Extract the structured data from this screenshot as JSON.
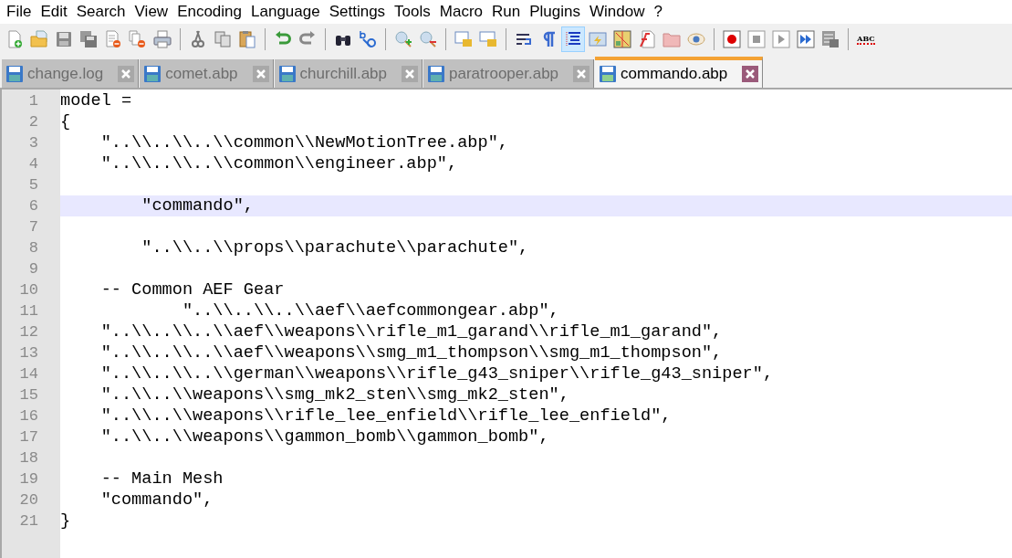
{
  "menu": [
    {
      "label": "File"
    },
    {
      "label": "Edit"
    },
    {
      "label": "Search"
    },
    {
      "label": "View"
    },
    {
      "label": "Encoding"
    },
    {
      "label": "Language"
    },
    {
      "label": "Settings"
    },
    {
      "label": "Tools"
    },
    {
      "label": "Macro"
    },
    {
      "label": "Run"
    },
    {
      "label": "Plugins"
    },
    {
      "label": "Window"
    },
    {
      "label": "?"
    }
  ],
  "toolbar": [
    {
      "kind": "new",
      "pressed": false
    },
    {
      "kind": "open",
      "pressed": false
    },
    {
      "kind": "save",
      "pressed": false
    },
    {
      "kind": "save-all",
      "pressed": false
    },
    {
      "kind": "close",
      "pressed": false
    },
    {
      "kind": "close-all",
      "pressed": false
    },
    {
      "kind": "print",
      "pressed": false
    },
    {
      "kind": "separator"
    },
    {
      "kind": "cut",
      "pressed": false
    },
    {
      "kind": "copy",
      "pressed": false
    },
    {
      "kind": "paste",
      "pressed": false
    },
    {
      "kind": "separator"
    },
    {
      "kind": "undo",
      "pressed": false
    },
    {
      "kind": "redo",
      "pressed": false
    },
    {
      "kind": "separator"
    },
    {
      "kind": "find",
      "pressed": false
    },
    {
      "kind": "replace",
      "pressed": false
    },
    {
      "kind": "separator"
    },
    {
      "kind": "zoom-in",
      "pressed": false
    },
    {
      "kind": "zoom-out",
      "pressed": false
    },
    {
      "kind": "separator"
    },
    {
      "kind": "sync-vertical",
      "pressed": false
    },
    {
      "kind": "sync-horizontal",
      "pressed": false
    },
    {
      "kind": "separator"
    },
    {
      "kind": "word-wrap",
      "pressed": false
    },
    {
      "kind": "show-all",
      "pressed": false
    },
    {
      "kind": "indent-guide",
      "pressed": true
    },
    {
      "kind": "language",
      "pressed": false
    },
    {
      "kind": "doc-map",
      "pressed": false
    },
    {
      "kind": "function-list",
      "pressed": false
    },
    {
      "kind": "folder",
      "pressed": false
    },
    {
      "kind": "monitor",
      "pressed": false
    },
    {
      "kind": "separator"
    },
    {
      "kind": "record",
      "pressed": false
    },
    {
      "kind": "stop",
      "pressed": false
    },
    {
      "kind": "play",
      "pressed": false
    },
    {
      "kind": "play-multiple",
      "pressed": false
    },
    {
      "kind": "save-macro",
      "pressed": false
    },
    {
      "kind": "separator"
    },
    {
      "kind": "spellcheck",
      "pressed": false,
      "label": "ABC"
    }
  ],
  "tabs": [
    {
      "label": "change.log",
      "selected": false
    },
    {
      "label": "comet.abp",
      "selected": false
    },
    {
      "label": "churchill.abp",
      "selected": false
    },
    {
      "label": "paratrooper.abp",
      "selected": false
    },
    {
      "label": "commando.abp",
      "selected": true
    }
  ],
  "editor": {
    "lines": [
      {
        "number": "1",
        "text": "model =",
        "current": false
      },
      {
        "number": "2",
        "text": "{",
        "current": false
      },
      {
        "number": "3",
        "text": "    \"..\\\\..\\\\..\\\\common\\\\NewMotionTree.abp\",",
        "current": false
      },
      {
        "number": "4",
        "text": "    \"..\\\\..\\\\..\\\\common\\\\engineer.abp\",",
        "current": false
      },
      {
        "number": "5",
        "current": false
      },
      {
        "number": "6",
        "text": "        \"commando\",",
        "current": true
      },
      {
        "number": "7",
        "current": false
      },
      {
        "number": "8",
        "text": "        \"..\\\\..\\\\props\\\\parachute\\\\parachute\",",
        "current": false
      },
      {
        "number": "9",
        "current": false
      },
      {
        "number": "10",
        "text": "    -- Common AEF Gear",
        "current": false
      },
      {
        "number": "11",
        "text": "            \"..\\\\..\\\\..\\\\aef\\\\aefcommongear.abp\",",
        "current": false
      },
      {
        "number": "12",
        "text": "    \"..\\\\..\\\\..\\\\aef\\\\weapons\\\\rifle_m1_garand\\\\rifle_m1_garand\",",
        "current": false
      },
      {
        "number": "13",
        "text": "    \"..\\\\..\\\\..\\\\aef\\\\weapons\\\\smg_m1_thompson\\\\smg_m1_thompson\",",
        "current": false
      },
      {
        "number": "14",
        "text": "    \"..\\\\..\\\\..\\\\german\\\\weapons\\\\rifle_g43_sniper\\\\rifle_g43_sniper\",",
        "current": false
      },
      {
        "number": "15",
        "text": "    \"..\\\\..\\\\weapons\\\\smg_mk2_sten\\\\smg_mk2_sten\",",
        "current": false
      },
      {
        "number": "16",
        "text": "    \"..\\\\..\\\\weapons\\\\rifle_lee_enfield\\\\rifle_lee_enfield\",",
        "current": false
      },
      {
        "number": "17",
        "text": "    \"..\\\\..\\\\weapons\\\\gammon_bomb\\\\gammon_bomb\",",
        "current": false
      },
      {
        "number": "18",
        "current": false
      },
      {
        "number": "19",
        "text": "    -- Main Mesh",
        "current": false
      },
      {
        "number": "20",
        "text": "    \"commando\",",
        "current": false
      },
      {
        "number": "21",
        "text": "}",
        "current": false
      }
    ]
  }
}
